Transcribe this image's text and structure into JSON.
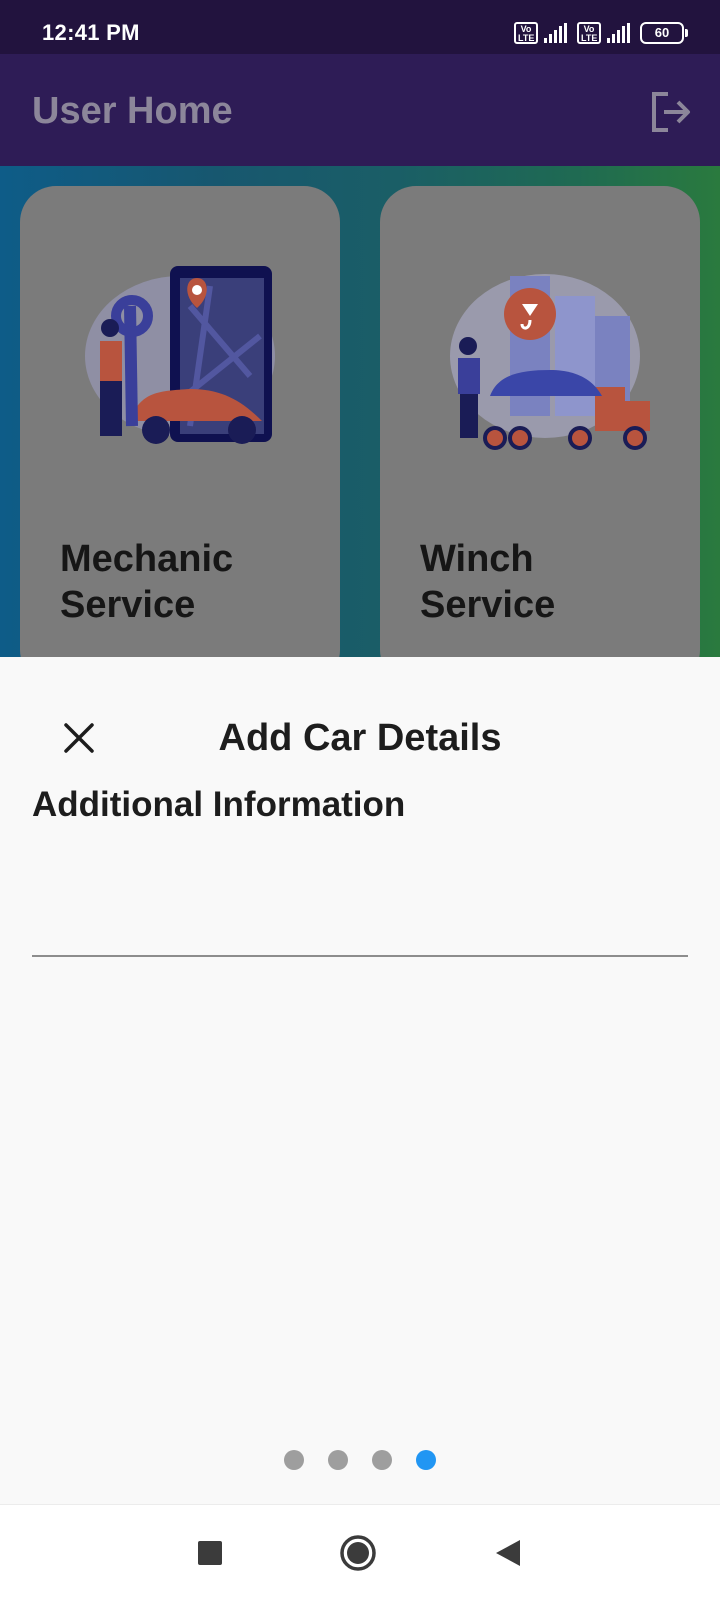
{
  "status_bar": {
    "time": "12:41 PM",
    "sim1_label": "Vo LTE",
    "sim2_label": "Vo LTE",
    "battery": "60"
  },
  "app_bar": {
    "title": "User Home",
    "logout_icon": "logout-icon"
  },
  "services": [
    {
      "label": "Mechanic Service",
      "illustration": "mechanic-illustration"
    },
    {
      "label": "Winch Service",
      "illustration": "tow-truck-illustration"
    }
  ],
  "sheet": {
    "title": "Add Car Details",
    "close_icon": "close-icon",
    "field_label": "Additional Information",
    "field_value": "",
    "field_placeholder": "",
    "page_indicator": {
      "total": 4,
      "current": 4
    }
  },
  "colors": {
    "status_bar": "#22133e",
    "app_bar": "#2e1c56",
    "active_dot": "#2196f3",
    "inactive_dot": "#9e9e9e"
  },
  "nav": {
    "recents_icon": "square-icon",
    "home_icon": "circle-icon",
    "back_icon": "triangle-back-icon"
  }
}
